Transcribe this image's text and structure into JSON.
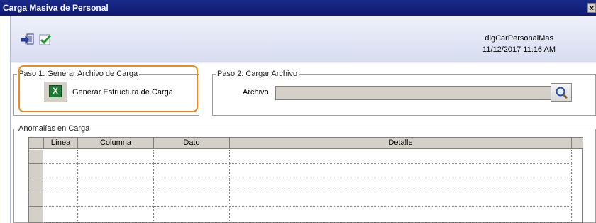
{
  "window": {
    "title": "Carga Masiva de Personal",
    "close_label": "×"
  },
  "toolbar": {
    "buttons": [
      {
        "name": "import-icon"
      },
      {
        "name": "check-icon"
      }
    ],
    "form_id": "dlgCarPersonalMas",
    "datetime": "11/12/2017 11:16 AM"
  },
  "paso1": {
    "legend": "Paso 1: Generar Archivo de Carga",
    "button_icon": "excel-icon",
    "button_label": "Generar Estructura de Carga"
  },
  "paso2": {
    "legend": "Paso 2: Cargar Archivo",
    "field_label": "Archivo",
    "field_value": "",
    "search_icon": "search-icon"
  },
  "anomalias": {
    "legend": "Anomalías en Carga",
    "columns": [
      "Línea",
      "Columna",
      "Dato",
      "Detalle"
    ],
    "rows": [
      [
        "",
        "",
        "",
        ""
      ],
      [
        "",
        "",
        "",
        ""
      ],
      [
        "",
        "",
        "",
        ""
      ],
      [
        "",
        "",
        "",
        ""
      ],
      [
        "",
        "",
        "",
        ""
      ]
    ]
  },
  "colors": {
    "titlebar": "#0e1a72",
    "highlight": "#f08a1c",
    "toolbar_bg": "#d7dcf0"
  }
}
